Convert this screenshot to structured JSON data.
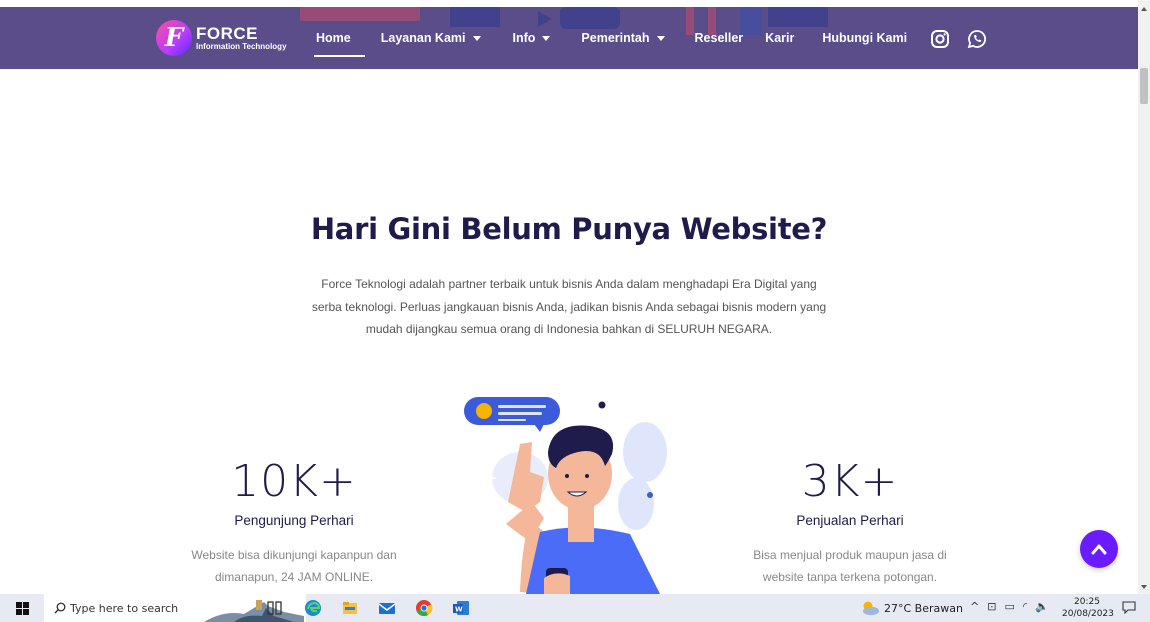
{
  "nav": {
    "logo_title": "FORCE",
    "logo_subtitle": "Information Technology",
    "links": [
      {
        "label": "Home",
        "active": true,
        "dropdown": false
      },
      {
        "label": "Layanan Kami",
        "dropdown": true
      },
      {
        "label": "Info",
        "dropdown": true
      },
      {
        "label": "Pemerintah",
        "dropdown": true
      },
      {
        "label": "Reseller",
        "dropdown": false
      },
      {
        "label": "Karir",
        "dropdown": false
      },
      {
        "label": "Hubungi Kami",
        "dropdown": false
      }
    ],
    "social_icons": [
      "instagram-icon",
      "whatsapp-icon"
    ]
  },
  "hero": {
    "title": "Hari Gini Belum Punya Website?",
    "description": "Force Teknologi adalah partner terbaik untuk bisnis Anda dalam menghadapi Era Digital yang serba teknologi. Perluas jangkauan bisnis Anda, jadikan bisnis Anda sebagai bisnis modern yang mudah dijangkau semua orang di Indonesia bahkan di SELURUH NEGARA."
  },
  "stats": [
    {
      "number": "10K+",
      "label": "Pengunjung Perhari",
      "desc_line1": "Website bisa dikunjungi kapanpun dan",
      "desc_line2": "dimanapun, 24 JAM ONLINE."
    },
    {
      "number": "3K+",
      "label": "Penjualan Perhari",
      "desc_line1": "Bisa menjual produk maupun jasa di",
      "desc_line2": "website tanpa terkena potongan."
    }
  ],
  "colors": {
    "nav_bg": "#5a4d8a",
    "heading": "#1f1b4a",
    "accent": "#6a1bff"
  },
  "taskbar": {
    "search_placeholder": "Type here to search",
    "weather": "27°C  Berawan",
    "time": "20:25",
    "date": "20/08/2023"
  }
}
